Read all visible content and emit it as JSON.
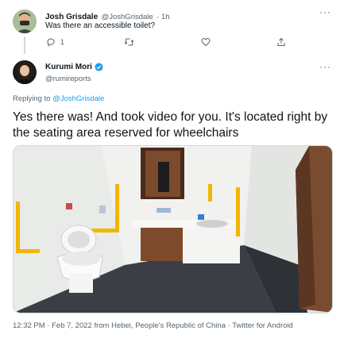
{
  "reply_tweet": {
    "author_name": "Josh Grisdale",
    "author_handle": "@JoshGrisdale",
    "time": "· 1h",
    "text": "Was there an accessible toilet?",
    "actions": {
      "reply_count": "1",
      "retweet_count": "",
      "like_count": ""
    }
  },
  "main_tweet": {
    "author_name": "Kurumi Mori",
    "author_handle": "@rumireports",
    "verified": true,
    "replying_prefix": "Replying to ",
    "replying_to": "@JoshGrisdale",
    "text": "Yes there was! And took video for you. It's located right by the seating area reserved for wheelchairs",
    "timestamp": "12:32 PM · Feb 7, 2022 from Hebei, People's Republic of China · Twitter for Android"
  },
  "colors": {
    "accent": "#1d9bf0",
    "muted": "#536471",
    "text": "#0f1419",
    "divider": "#cfd9de"
  },
  "icons": [
    "reply-icon",
    "retweet-icon",
    "like-icon",
    "share-icon",
    "more-icon",
    "verified-badge-icon"
  ]
}
